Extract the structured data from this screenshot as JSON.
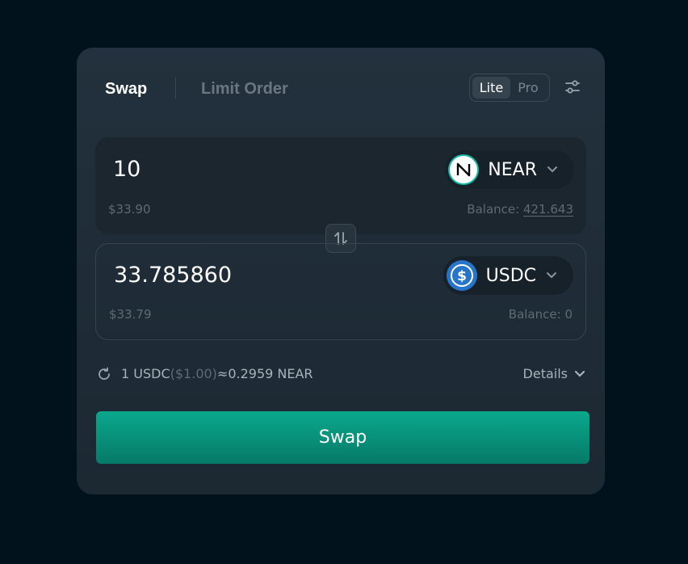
{
  "tabs": {
    "swap": "Swap",
    "limit_order": "Limit Order"
  },
  "mode": {
    "lite": "Lite",
    "pro": "Pro",
    "selected": "Lite"
  },
  "from": {
    "amount": "10",
    "token": "NEAR",
    "usd_value": "$33.90",
    "balance_label": "Balance:",
    "balance_value": "421.643"
  },
  "to": {
    "amount": "33.785860",
    "token": "USDC",
    "usd_value": "$33.79",
    "balance_label": "Balance:",
    "balance_value": "0"
  },
  "rate": {
    "base": "1 USDC",
    "base_usd": "($1.00)",
    "approx": "≈",
    "quote": "0.2959 NEAR"
  },
  "details_label": "Details",
  "swap_button_label": "Swap",
  "colors": {
    "accent": "#0aa88d",
    "background": "#02121d",
    "card": "#22313d",
    "usdc_blue": "#2775ca"
  },
  "icons": {
    "settings": "sliders-icon",
    "flip": "swap-arrows-icon",
    "refresh": "refresh-icon",
    "chevron": "chevron-down-icon"
  }
}
